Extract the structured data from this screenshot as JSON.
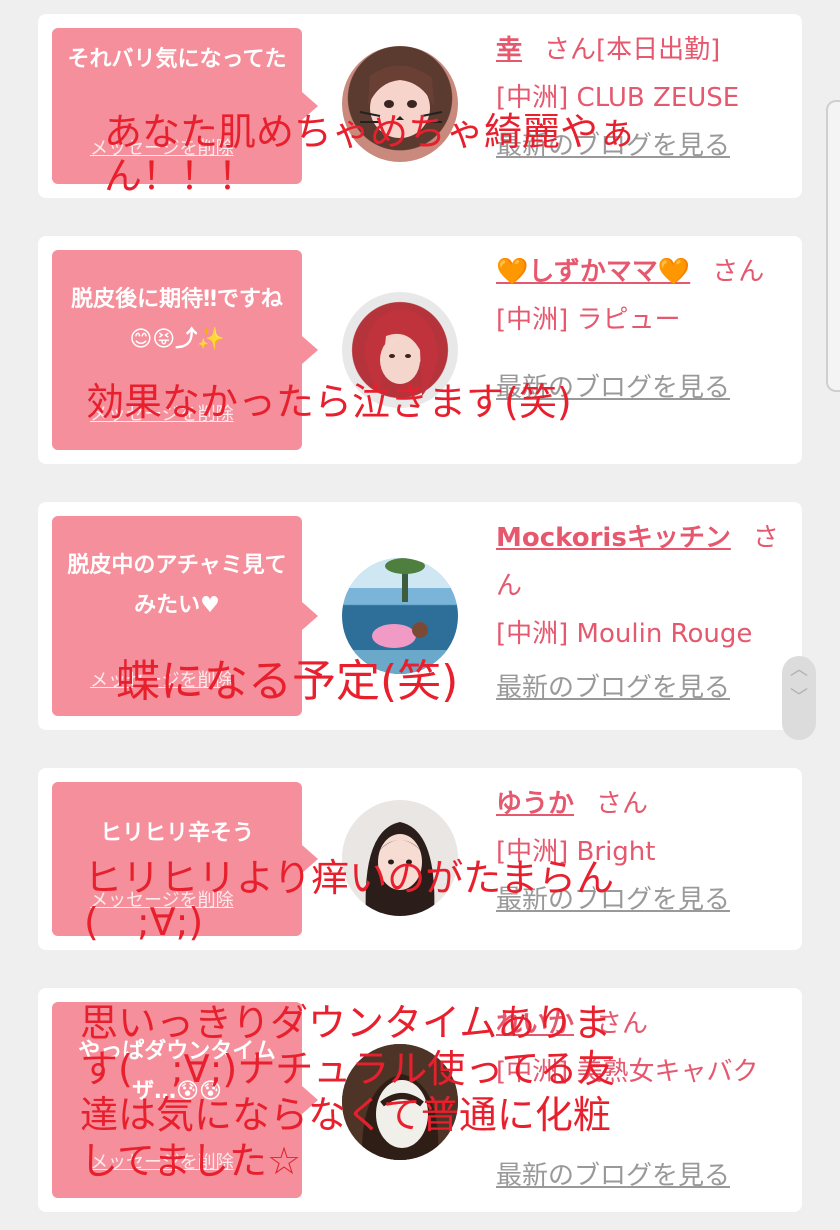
{
  "items": [
    {
      "message": "それバリ気になってた",
      "delete_label": "メッセージを削除",
      "name": "幸",
      "san": "さん[本日出勤]",
      "shop": "[中洲] CLUB ZEUSE",
      "blog": "最新のブログを見る",
      "overlay": "あなた肌めちゃめちゃ綺麗やぁ\nん！！！"
    },
    {
      "message": "脱皮後に期待‼ですね😊😝⤴✨",
      "delete_label": "メッセージを削除",
      "name": "🧡しずかママ🧡",
      "san": "さん",
      "shop": "[中洲] ラピュー",
      "blog": "最新のブログを見る",
      "overlay": "効果なかったら泣きます(笑)"
    },
    {
      "message": "脱皮中のアチャミ見てみたい♥",
      "delete_label": "メッセージを削除",
      "name": "Mockorisキッチン",
      "san": "さん",
      "shop": "[中洲] Moulin Rouge",
      "blog": "最新のブログを見る",
      "overlay": "蝶になる予定(笑)"
    },
    {
      "message": "ヒリヒリ辛そう",
      "delete_label": "メッセージを削除",
      "name": "ゆうか",
      "san": "さん",
      "shop": "[中洲] Bright",
      "blog": "最新のブログを見る",
      "overlay": "ヒリヒリより痒いのがたまらん\n(　;∀;)"
    },
    {
      "message": "やっぱダウンタイムザ…😰😰",
      "delete_label": "メッセージを削除",
      "name": "れいか",
      "san": "さん",
      "shop": "[中洲] 美熟女キャバク",
      "blog": "最新のブログを見る",
      "overlay": "思いっきりダウンタイムありま\nす(　;∀;)ナチュラル使ってる友\n達は気にならなくて普通に化粧\nしてました☆"
    }
  ],
  "colors": {
    "bubble": "#f58f9b",
    "accent": "#e5586e",
    "overlay_text": "#e8202e",
    "background": "#efefef"
  },
  "scroll_icons": {
    "up": "chevron-up-icon",
    "down": "chevron-down-icon"
  }
}
